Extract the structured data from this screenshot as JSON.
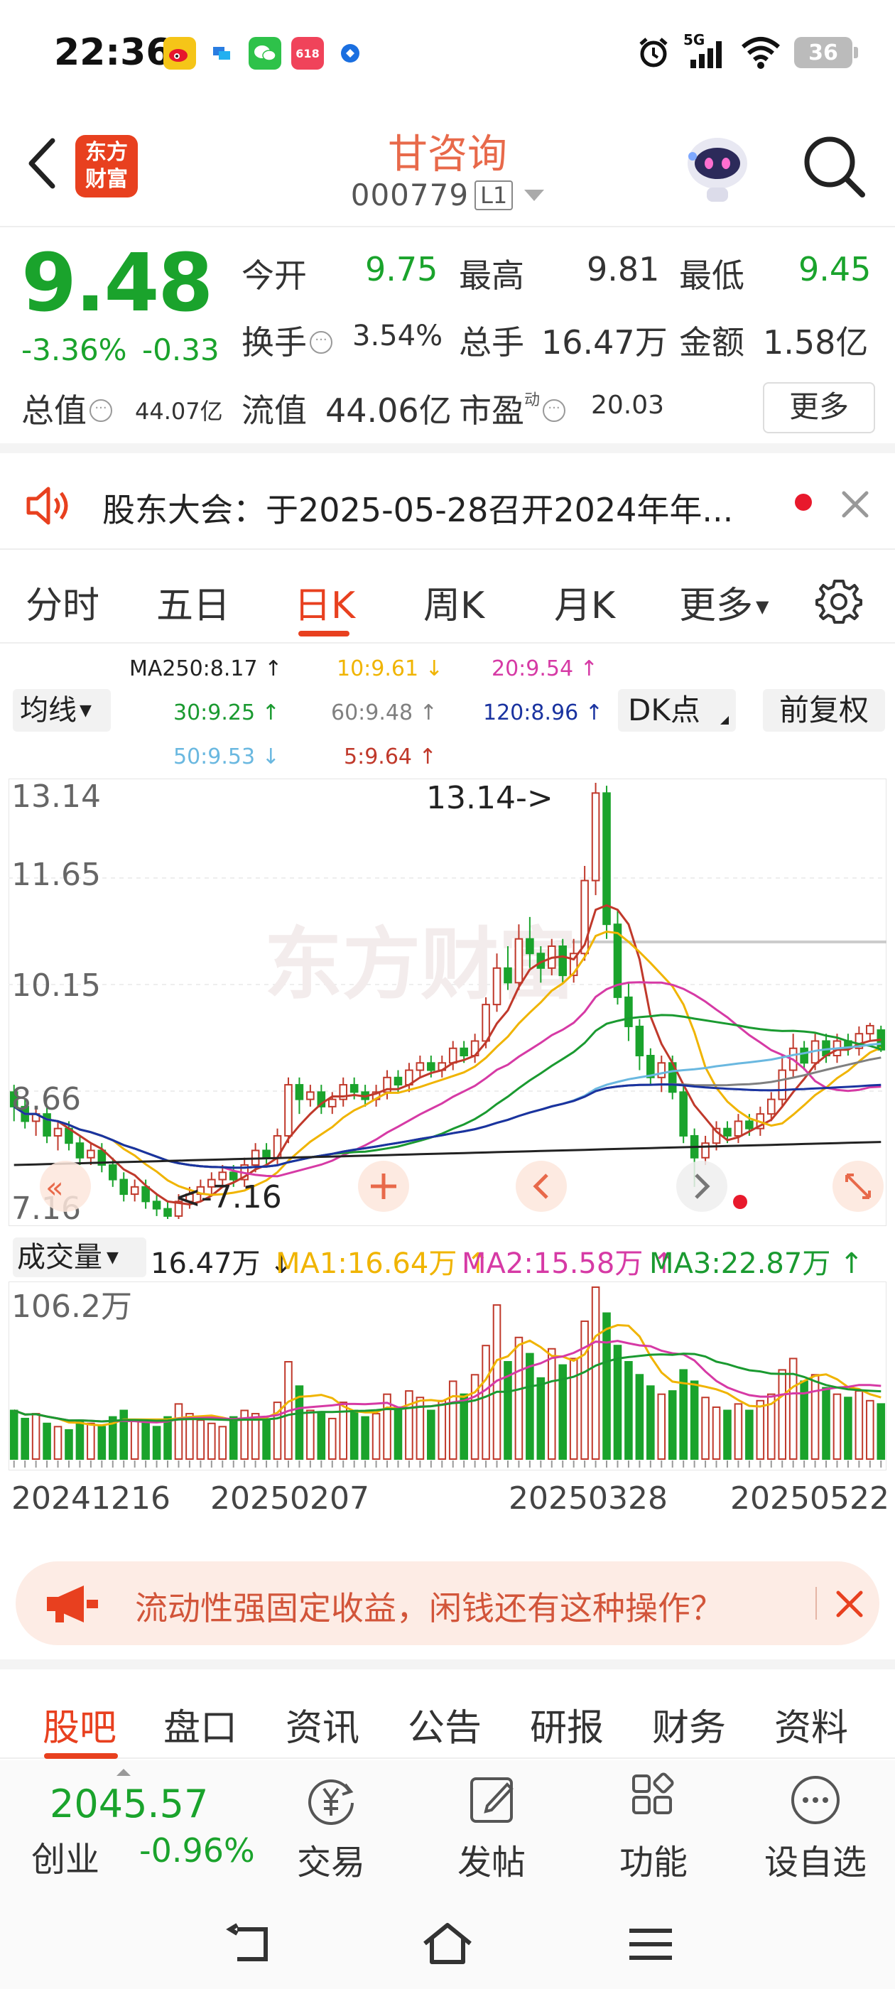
{
  "status_bar": {
    "time": "22:36",
    "network": "5G",
    "battery": "36",
    "app_icons": [
      "weibo-icon",
      "app-icon",
      "wechat-icon",
      "shopping-618-icon",
      "browser-icon"
    ]
  },
  "header": {
    "logo_text": "东方财富",
    "stock_name": "甘咨询",
    "stock_code": "000779",
    "level": "L1"
  },
  "quote": {
    "price": "9.48",
    "change_pct": "-3.36%",
    "change_abs": "-0.33",
    "open_label": "今开",
    "open": "9.75",
    "high_label": "最高",
    "high": "9.81",
    "low_label": "最低",
    "low": "9.45",
    "turnover_label": "换手",
    "turnover": "3.54%",
    "volume_label": "总手",
    "volume": "16.47万",
    "amount_label": "金额",
    "amount": "1.58亿",
    "mktcap_label": "总值",
    "mktcap": "44.07亿",
    "float_label": "流值",
    "float_cap": "44.06亿",
    "pe_label": "市盈",
    "pe_sup": "动",
    "pe": "20.03",
    "more_label": "更多"
  },
  "notice": {
    "text": "股东大会：于2025-05-28召开2024年年..."
  },
  "tabs": {
    "items": [
      "分时",
      "五日",
      "日K",
      "周K",
      "月K",
      "更多"
    ],
    "active": "日K"
  },
  "ma_legend": {
    "ma250": "MA250:8.17 ↑",
    "ma10": "10:9.61 ↓",
    "ma20": "20:9.54 ↑",
    "ma30": "30:9.25 ↑",
    "ma60": "60:9.48 ↑",
    "ma120": "120:8.96 ↑",
    "ma50": "50:9.53 ↓",
    "ma5": "5:9.64 ↑",
    "junxian": "均线",
    "dk": "DK点",
    "fuquan": "前复权"
  },
  "colors": {
    "up": "#c0392b",
    "down": "#1aa32c",
    "accent": "#e8401f",
    "ma5": "#c0392b",
    "ma10": "#f0b400",
    "ma20": "#d63aa5",
    "ma30": "#1a9a30",
    "ma50": "#6ab8e0",
    "ma60": "#808080",
    "ma120": "#1a33a0",
    "ma250": "#222222"
  },
  "kline": {
    "y_labels": [
      "13.14",
      "11.65",
      "10.15",
      "8.66",
      "7.16"
    ],
    "max_label": "13.14->",
    "min_label": "<-7.16",
    "watermark": "东方财富"
  },
  "volume": {
    "selector": "成交量",
    "current": "16.47万 ↓",
    "ma1": "MA1:16.64万 ↑",
    "ma2": "MA2:15.58万 ↑",
    "ma3": "MA3:22.87万 ↑",
    "max_label": "106.2万"
  },
  "dates": [
    "20241216",
    "20250207",
    "20250328",
    "20250522"
  ],
  "chart_data": {
    "type": "candlestick",
    "title": "",
    "y_range": [
      7.16,
      13.14
    ],
    "x_labels": [
      "20241216",
      "20250207",
      "20250328",
      "20250522"
    ],
    "max_price": 13.14,
    "min_price": 7.16,
    "volume_max": "106.2万",
    "candles": [
      [
        8.9,
        8.7,
        9.0,
        8.5
      ],
      [
        8.7,
        8.5,
        8.8,
        8.4
      ],
      [
        8.5,
        8.6,
        8.7,
        8.3
      ],
      [
        8.6,
        8.3,
        8.7,
        8.2
      ],
      [
        8.3,
        8.4,
        8.5,
        8.1
      ],
      [
        8.4,
        8.2,
        8.5,
        8.1
      ],
      [
        8.2,
        8.0,
        8.3,
        7.9
      ],
      [
        8.0,
        8.1,
        8.2,
        7.9
      ],
      [
        8.1,
        7.9,
        8.2,
        7.8
      ],
      [
        7.9,
        7.7,
        8.0,
        7.6
      ],
      [
        7.7,
        7.5,
        7.8,
        7.4
      ],
      [
        7.5,
        7.6,
        7.7,
        7.4
      ],
      [
        7.6,
        7.4,
        7.7,
        7.3
      ],
      [
        7.4,
        7.3,
        7.5,
        7.2
      ],
      [
        7.3,
        7.2,
        7.4,
        7.16
      ],
      [
        7.2,
        7.4,
        7.5,
        7.16
      ],
      [
        7.4,
        7.5,
        7.6,
        7.3
      ],
      [
        7.5,
        7.6,
        7.7,
        7.4
      ],
      [
        7.6,
        7.7,
        7.8,
        7.5
      ],
      [
        7.7,
        7.8,
        7.9,
        7.6
      ],
      [
        7.8,
        7.7,
        7.9,
        7.6
      ],
      [
        7.7,
        7.9,
        8.0,
        7.6
      ],
      [
        7.9,
        8.1,
        8.2,
        7.8
      ],
      [
        8.1,
        8.0,
        8.2,
        7.9
      ],
      [
        8.0,
        8.3,
        8.4,
        7.9
      ],
      [
        8.3,
        9.0,
        9.1,
        8.2
      ],
      [
        9.0,
        8.8,
        9.1,
        8.6
      ],
      [
        8.8,
        8.9,
        9.0,
        8.7
      ],
      [
        8.9,
        8.7,
        9.0,
        8.6
      ],
      [
        8.7,
        8.8,
        8.9,
        8.6
      ],
      [
        8.8,
        9.0,
        9.1,
        8.7
      ],
      [
        9.0,
        8.9,
        9.1,
        8.8
      ],
      [
        8.9,
        8.8,
        9.0,
        8.7
      ],
      [
        8.8,
        8.9,
        9.0,
        8.7
      ],
      [
        8.9,
        9.1,
        9.2,
        8.8
      ],
      [
        9.1,
        9.0,
        9.2,
        8.9
      ],
      [
        9.0,
        9.2,
        9.3,
        8.9
      ],
      [
        9.2,
        9.3,
        9.4,
        9.1
      ],
      [
        9.3,
        9.2,
        9.4,
        9.1
      ],
      [
        9.2,
        9.3,
        9.4,
        9.1
      ],
      [
        9.3,
        9.5,
        9.6,
        9.2
      ],
      [
        9.5,
        9.4,
        9.6,
        9.3
      ],
      [
        9.4,
        9.6,
        9.7,
        9.3
      ],
      [
        9.6,
        10.1,
        10.2,
        9.5
      ],
      [
        10.1,
        10.6,
        10.8,
        10.0
      ],
      [
        10.6,
        10.4,
        10.9,
        10.3
      ],
      [
        10.4,
        11.0,
        11.2,
        10.3
      ],
      [
        11.0,
        10.8,
        11.3,
        10.6
      ],
      [
        10.8,
        10.6,
        10.9,
        10.4
      ],
      [
        10.6,
        10.9,
        11.0,
        10.5
      ],
      [
        10.9,
        10.5,
        11.0,
        10.4
      ],
      [
        10.5,
        10.8,
        11.0,
        10.4
      ],
      [
        10.8,
        11.8,
        12.0,
        10.7
      ],
      [
        11.8,
        13.0,
        13.14,
        11.6
      ],
      [
        13.0,
        11.2,
        13.1,
        11.0
      ],
      [
        11.2,
        10.2,
        11.4,
        10.1
      ],
      [
        10.2,
        9.8,
        10.4,
        9.6
      ],
      [
        9.8,
        9.4,
        9.9,
        9.2
      ],
      [
        9.4,
        9.1,
        9.5,
        9.0
      ],
      [
        9.1,
        9.3,
        9.4,
        8.9
      ],
      [
        9.3,
        8.9,
        9.4,
        8.8
      ],
      [
        8.9,
        8.3,
        9.0,
        8.2
      ],
      [
        8.3,
        8.0,
        8.4,
        7.6
      ],
      [
        8.0,
        8.2,
        8.3,
        7.9
      ],
      [
        8.2,
        8.4,
        8.5,
        8.1
      ],
      [
        8.4,
        8.3,
        8.5,
        8.2
      ],
      [
        8.3,
        8.5,
        8.6,
        8.2
      ],
      [
        8.5,
        8.4,
        8.6,
        8.3
      ],
      [
        8.4,
        8.6,
        8.7,
        8.3
      ],
      [
        8.6,
        8.8,
        8.9,
        8.5
      ],
      [
        8.8,
        9.2,
        9.4,
        8.7
      ],
      [
        9.2,
        9.5,
        9.7,
        9.1
      ],
      [
        9.5,
        9.3,
        9.6,
        9.2
      ],
      [
        9.3,
        9.6,
        9.7,
        9.2
      ],
      [
        9.6,
        9.4,
        9.7,
        9.3
      ],
      [
        9.4,
        9.6,
        9.7,
        9.3
      ],
      [
        9.6,
        9.5,
        9.7,
        9.4
      ],
      [
        9.5,
        9.7,
        9.8,
        9.4
      ],
      [
        9.7,
        9.81,
        9.85,
        9.6
      ],
      [
        9.75,
        9.48,
        9.81,
        9.45
      ]
    ],
    "volumes": [
      30,
      25,
      28,
      22,
      20,
      18,
      24,
      22,
      20,
      26,
      30,
      24,
      22,
      20,
      26,
      34,
      28,
      24,
      22,
      20,
      26,
      30,
      28,
      24,
      35,
      60,
      45,
      30,
      28,
      25,
      35,
      30,
      26,
      28,
      40,
      32,
      42,
      38,
      30,
      36,
      48,
      40,
      52,
      70,
      95,
      60,
      75,
      65,
      50,
      68,
      58,
      62,
      85,
      106,
      90,
      70,
      60,
      52,
      45,
      40,
      42,
      55,
      48,
      38,
      32,
      30,
      34,
      30,
      36,
      40,
      55,
      62,
      48,
      52,
      44,
      40,
      38,
      42,
      36,
      34
    ]
  },
  "promo": {
    "text": "流动性强固定收益，闲钱还有这种操作？"
  },
  "bottom_tabs": {
    "items": [
      "股吧",
      "盘口",
      "资讯",
      "公告",
      "研报",
      "财务",
      "资料"
    ],
    "active": "股吧"
  },
  "toolbar": {
    "index_value": "2045.57",
    "index_name": "创业",
    "index_change": "-0.96%",
    "trade": "交易",
    "post": "发帖",
    "func": "功能",
    "watch": "设自选"
  }
}
